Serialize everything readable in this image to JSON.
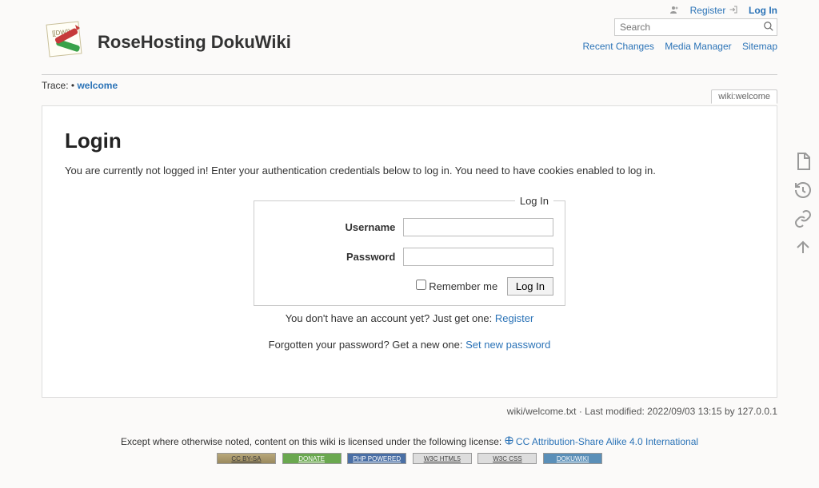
{
  "user_tools": {
    "register": "Register",
    "login": "Log In"
  },
  "site": {
    "title": "RoseHosting DokuWiki"
  },
  "search": {
    "placeholder": "Search"
  },
  "site_tools": {
    "recent_changes": "Recent Changes",
    "media_manager": "Media Manager",
    "sitemap": "Sitemap"
  },
  "trace": {
    "label": "Trace:",
    "separator": "•",
    "welcome": "welcome"
  },
  "page_tab": "wiki:welcome",
  "login": {
    "heading": "Login",
    "intro": "You are currently not logged in! Enter your authentication credentials below to log in. You need to have cookies enabled to log in.",
    "legend": "Log In",
    "username_label": "Username",
    "password_label": "Password",
    "remember_label": "Remember me",
    "submit": "Log In",
    "no_account_text": "You don't have an account yet? Just get one: ",
    "register_link": "Register",
    "forgot_text": "Forgotten your password? Get a new one: ",
    "forgot_link": "Set new password"
  },
  "docinfo": "wiki/welcome.txt · Last modified: 2022/09/03 13:15 by 127.0.0.1",
  "license": {
    "text": "Except where otherwise noted, content on this wiki is licensed under the following license: ",
    "link": "CC Attribution-Share Alike 4.0 International"
  },
  "badges": {
    "cc": "CC BY-SA",
    "donate": "DONATE",
    "php": "PHP POWERED",
    "html5": "W3C HTML5",
    "css": "W3C CSS",
    "dw": "DOKUWIKI"
  }
}
